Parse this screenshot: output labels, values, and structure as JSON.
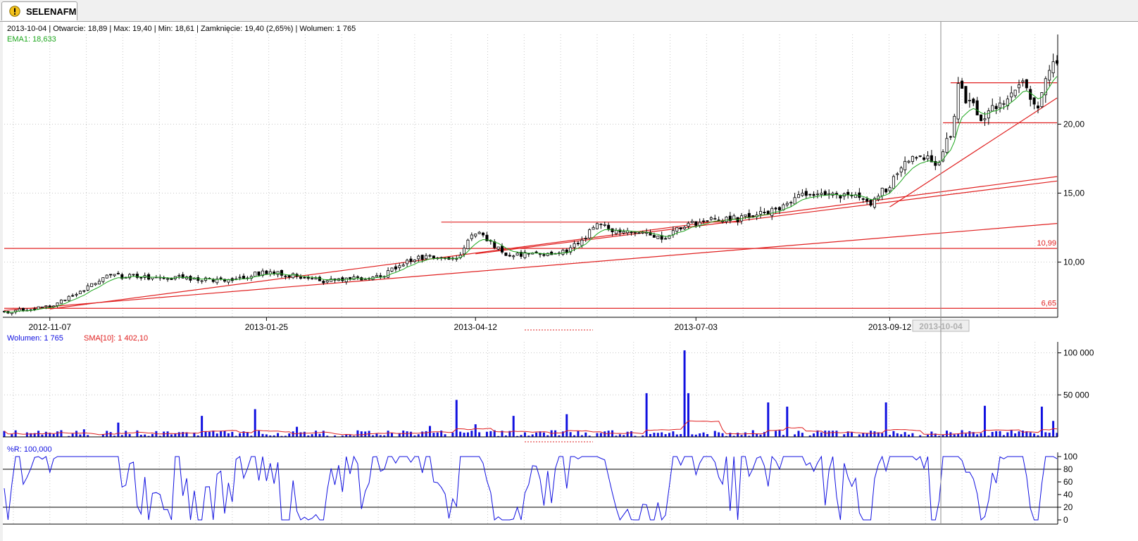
{
  "tab": {
    "title": "SELENAFM",
    "icon": "warning-icon"
  },
  "chart_data": [
    {
      "type": "candlestick",
      "panel": "price",
      "info_line": "2013-10-04 | Otwarcie: 18,89 | Max: 19,40 | Min: 18,61 | Zamknięcie: 19,40 (2,65%) | Wolumen: 1 765",
      "ema_label": "EMA1: 18,633",
      "y_ticks": [
        "10,00",
        "15,00",
        "20,00"
      ],
      "ylim": [
        6.0,
        26.5
      ],
      "x_ticks": [
        "2012-11-07",
        "2013-01-25",
        "2013-04-12",
        "2013-07-03",
        "2013-09-12"
      ],
      "cursor_date": "2013-10-04",
      "level_labels": [
        "10,99",
        "6,65"
      ],
      "trend_anchor_closes": [
        {
          "date": "2012-10-25",
          "close": 6.5
        },
        {
          "date": "2012-11-07",
          "close": 6.8
        },
        {
          "date": "2012-11-20",
          "close": 8.0
        },
        {
          "date": "2012-11-28",
          "close": 9.0
        },
        {
          "date": "2012-12-20",
          "close": 8.9
        },
        {
          "date": "2013-01-10",
          "close": 8.7
        },
        {
          "date": "2013-01-25",
          "close": 9.3
        },
        {
          "date": "2013-02-18",
          "close": 8.6
        },
        {
          "date": "2013-03-08",
          "close": 9.0
        },
        {
          "date": "2013-03-22",
          "close": 10.4
        },
        {
          "date": "2013-04-05",
          "close": 10.3
        },
        {
          "date": "2013-04-12",
          "close": 12.2
        },
        {
          "date": "2013-04-24",
          "close": 10.5
        },
        {
          "date": "2013-05-16",
          "close": 10.8
        },
        {
          "date": "2013-05-28",
          "close": 12.6
        },
        {
          "date": "2013-06-20",
          "close": 11.8
        },
        {
          "date": "2013-07-03",
          "close": 12.9
        },
        {
          "date": "2013-07-25",
          "close": 13.3
        },
        {
          "date": "2013-08-12",
          "close": 14.8
        },
        {
          "date": "2013-08-29",
          "close": 14.9
        },
        {
          "date": "2013-09-05",
          "close": 14.3
        },
        {
          "date": "2013-09-12",
          "close": 15.6
        },
        {
          "date": "2013-09-20",
          "close": 17.9
        },
        {
          "date": "2013-10-01",
          "close": 17.2
        },
        {
          "date": "2013-10-04",
          "close": 19.4
        },
        {
          "date": "2013-10-08",
          "close": 22.5
        },
        {
          "date": "2013-10-16",
          "close": 20.6
        },
        {
          "date": "2013-10-31",
          "close": 22.7
        },
        {
          "date": "2013-11-06",
          "close": 21.0
        },
        {
          "date": "2013-11-11",
          "close": 24.0
        }
      ],
      "trendlines": [
        {
          "from": [
            "2012-10-22",
            6.5
          ],
          "to": [
            "2013-11-13",
            12.8
          ]
        },
        {
          "from": [
            "2012-11-07",
            6.6
          ],
          "to": [
            "2013-11-13",
            16.2
          ]
        },
        {
          "from": [
            "2013-04-12",
            10.6
          ],
          "to": [
            "2013-07-03",
            12.6
          ],
          "extend_to": "2013-11-13"
        },
        {
          "from": [
            "2013-09-12",
            14.0
          ],
          "to": [
            "2013-11-13",
            21.9
          ]
        }
      ],
      "horizontal_levels": [
        {
          "value": 10.99,
          "from": "2012-10-22",
          "to": "2013-11-13"
        },
        {
          "value": 6.65,
          "from": "2012-10-22",
          "to": "2013-11-13"
        },
        {
          "value": 12.9,
          "from": "2013-04-01",
          "to": "2013-07-20"
        },
        {
          "value": 23.0,
          "from": "2013-10-04",
          "to": "2013-11-13"
        },
        {
          "value": 20.1,
          "from": "2013-10-02",
          "to": "2013-11-13"
        }
      ]
    },
    {
      "type": "bar",
      "panel": "volume",
      "volume_label": "Wolumen: 1 765",
      "sma_label": "SMA[10]: 1 402,10",
      "y_ticks": [
        "50 000",
        "100 000"
      ],
      "ylim": [
        0,
        108000
      ],
      "spikes": [
        {
          "date": "2012-11-20",
          "value": 9000
        },
        {
          "date": "2012-12-03",
          "value": 17000
        },
        {
          "date": "2013-01-02",
          "value": 25000
        },
        {
          "date": "2013-01-22",
          "value": 33000
        },
        {
          "date": "2013-02-06",
          "value": 12000
        },
        {
          "date": "2013-03-27",
          "value": 13000
        },
        {
          "date": "2013-04-05",
          "value": 44000
        },
        {
          "date": "2013-04-12",
          "value": 15000
        },
        {
          "date": "2013-04-26",
          "value": 25000
        },
        {
          "date": "2013-05-16",
          "value": 27000
        },
        {
          "date": "2013-06-14",
          "value": 52000
        },
        {
          "date": "2013-06-28",
          "value": 103000
        },
        {
          "date": "2013-07-01",
          "value": 52000
        },
        {
          "date": "2013-07-30",
          "value": 41000
        },
        {
          "date": "2013-08-06",
          "value": 36000
        },
        {
          "date": "2013-09-11",
          "value": 41000
        },
        {
          "date": "2013-10-17",
          "value": 37000
        },
        {
          "date": "2013-11-07",
          "value": 36000
        },
        {
          "date": "2013-11-12",
          "value": 19000
        }
      ]
    },
    {
      "type": "line",
      "panel": "williams-r",
      "label": "%R: 100,000",
      "y_ticks": [
        "0",
        "20",
        "40",
        "60",
        "80",
        "100"
      ],
      "ylim": [
        0,
        100
      ],
      "reference_lines": [
        20,
        80
      ]
    }
  ]
}
